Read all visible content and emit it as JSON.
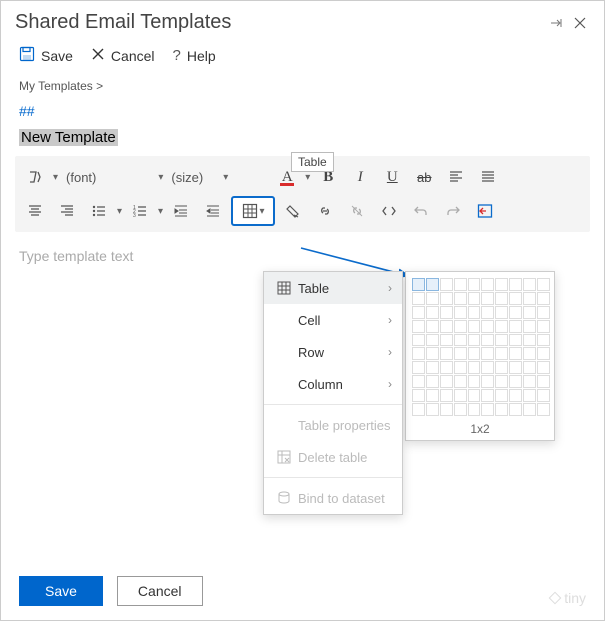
{
  "titlebar": {
    "title": "Shared Email Templates"
  },
  "actions": {
    "save": "Save",
    "cancel": "Cancel",
    "help": "Help"
  },
  "breadcrumb": "My Templates >",
  "hash": "##",
  "template_name": "New Template",
  "toolbar": {
    "font_label": "(font)",
    "size_label": "(size)",
    "tooltip": "Table"
  },
  "editor": {
    "placeholder": "Type template text"
  },
  "menu": {
    "table": "Table",
    "cell": "Cell",
    "row": "Row",
    "column": "Column",
    "table_props": "Table properties",
    "delete_table": "Delete table",
    "bind_dataset": "Bind to dataset"
  },
  "grid": {
    "label": "1x2"
  },
  "footer": {
    "save": "Save",
    "cancel": "Cancel"
  },
  "tiny": "tiny"
}
